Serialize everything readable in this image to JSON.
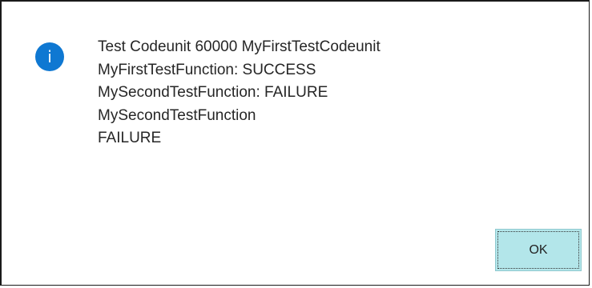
{
  "dialog": {
    "icon": "info-icon",
    "accent_color": "#0f78d2",
    "icon_glyph": "i",
    "message_lines": [
      "Test Codeunit 60000 MyFirstTestCodeunit",
      "MyFirstTestFunction: SUCCESS",
      "MySecondTestFunction: FAILURE",
      "MySecondTestFunction",
      "FAILURE"
    ],
    "ok_label": "OK",
    "ok_button_color": "#b3e6ea"
  }
}
